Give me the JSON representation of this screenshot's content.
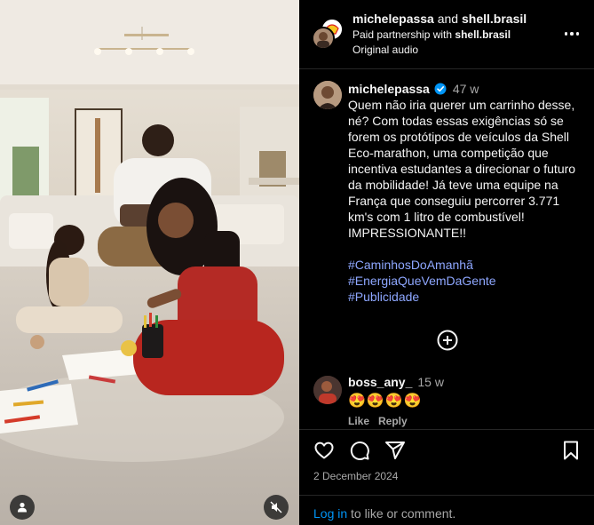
{
  "header": {
    "account": "michelepassa",
    "conjunction": "and",
    "partner": "shell.brasil",
    "paid_partnership_prefix": "Paid partnership with",
    "paid_partnership_name": "shell.brasil",
    "audio": "Original audio"
  },
  "caption": {
    "username": "michelepassa",
    "time": "47 w",
    "text": "Quem não iria querer um carrinho desse, né? Com todas essas exigências só se forem os protótipos de veículos da Shell Eco-marathon, uma competição que incentiva estudantes a direcionar o futuro da mobilidade! Já teve uma equipe na França que conseguiu percorrer 3.771 km's com 1 litro de combustível! IMPRESSIONANTE!!",
    "hashtags": [
      "#CaminhosDoAmanhã",
      "#EnergiaQueVemDaGente",
      "#Publicidade"
    ]
  },
  "comments": [
    {
      "username": "boss_any_",
      "time": "15 w",
      "text": "😍😍😍😍",
      "like_label": "Like",
      "reply_label": "Reply"
    }
  ],
  "footer": {
    "date": "2 December 2024",
    "login_link": "Log in",
    "login_suffix": " to like or comment."
  },
  "icons": {
    "more": "more-options-icon",
    "verified": "verified-badge-icon",
    "load_more": "plus-circle-icon",
    "like": "heart-icon",
    "comment": "comment-bubble-icon",
    "share": "paper-plane-icon",
    "save": "bookmark-icon",
    "user_tag": "user-icon",
    "mute": "speaker-muted-icon"
  },
  "colors": {
    "background": "#000000",
    "text": "#f5f5f5",
    "secondary_text": "#a8a8a8",
    "hashtag": "#8ea7ff",
    "link": "#0095f6",
    "verified": "#0095f6",
    "divider": "#262626"
  }
}
